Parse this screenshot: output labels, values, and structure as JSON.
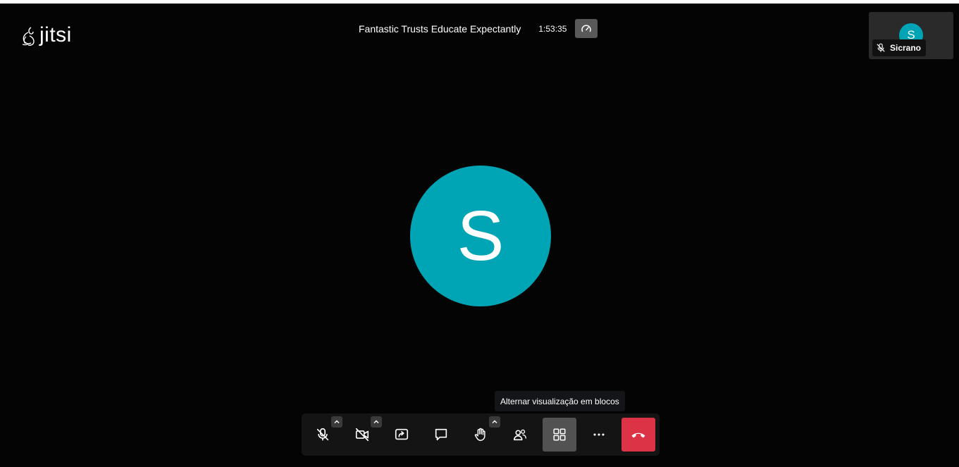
{
  "brand": {
    "name": "jitsi"
  },
  "header": {
    "subject": "Fantastic Trusts Educate Expectantly",
    "timer": "1:53:35",
    "quality_icon": "gauge-icon"
  },
  "main": {
    "avatar_initial": "S",
    "avatar_color": "#00a5b5"
  },
  "thumbnail": {
    "avatar_initial": "S",
    "name": "Sicrano",
    "muted_icon": "mic-off-icon"
  },
  "tooltip": {
    "text": "Alternar visualização em blocos"
  },
  "toolbar": {
    "buttons": [
      {
        "name": "microphone",
        "icon": "mic-off-icon"
      },
      {
        "name": "camera",
        "icon": "camera-off-icon"
      },
      {
        "name": "share-screen",
        "icon": "screen-share-icon"
      },
      {
        "name": "chat",
        "icon": "chat-icon"
      },
      {
        "name": "raise-hand",
        "icon": "hand-icon"
      },
      {
        "name": "participants",
        "icon": "participants-icon"
      },
      {
        "name": "tile-view",
        "icon": "grid-icon"
      },
      {
        "name": "more",
        "icon": "more-icon"
      },
      {
        "name": "hangup",
        "icon": "hangup-icon"
      }
    ],
    "hangup_color": "#dd3346"
  }
}
